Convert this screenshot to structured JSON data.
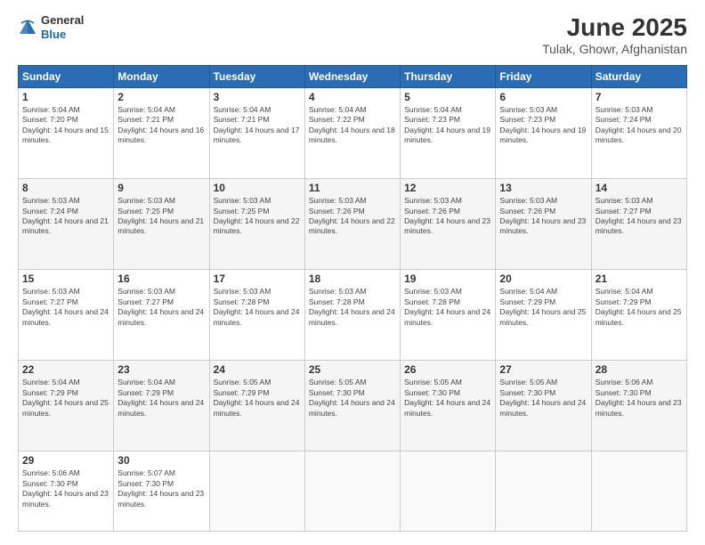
{
  "header": {
    "logo_general": "General",
    "logo_blue": "Blue",
    "title": "June 2025",
    "subtitle": "Tulak, Ghowr, Afghanistan"
  },
  "days_of_week": [
    "Sunday",
    "Monday",
    "Tuesday",
    "Wednesday",
    "Thursday",
    "Friday",
    "Saturday"
  ],
  "weeks": [
    [
      {
        "day": "1",
        "sunrise": "5:04 AM",
        "sunset": "7:20 PM",
        "daylight": "14 hours and 15 minutes."
      },
      {
        "day": "2",
        "sunrise": "5:04 AM",
        "sunset": "7:21 PM",
        "daylight": "14 hours and 16 minutes."
      },
      {
        "day": "3",
        "sunrise": "5:04 AM",
        "sunset": "7:21 PM",
        "daylight": "14 hours and 17 minutes."
      },
      {
        "day": "4",
        "sunrise": "5:04 AM",
        "sunset": "7:22 PM",
        "daylight": "14 hours and 18 minutes."
      },
      {
        "day": "5",
        "sunrise": "5:04 AM",
        "sunset": "7:23 PM",
        "daylight": "14 hours and 19 minutes."
      },
      {
        "day": "6",
        "sunrise": "5:03 AM",
        "sunset": "7:23 PM",
        "daylight": "14 hours and 19 minutes."
      },
      {
        "day": "7",
        "sunrise": "5:03 AM",
        "sunset": "7:24 PM",
        "daylight": "14 hours and 20 minutes."
      }
    ],
    [
      {
        "day": "8",
        "sunrise": "5:03 AM",
        "sunset": "7:24 PM",
        "daylight": "14 hours and 21 minutes."
      },
      {
        "day": "9",
        "sunrise": "5:03 AM",
        "sunset": "7:25 PM",
        "daylight": "14 hours and 21 minutes."
      },
      {
        "day": "10",
        "sunrise": "5:03 AM",
        "sunset": "7:25 PM",
        "daylight": "14 hours and 22 minutes."
      },
      {
        "day": "11",
        "sunrise": "5:03 AM",
        "sunset": "7:26 PM",
        "daylight": "14 hours and 22 minutes."
      },
      {
        "day": "12",
        "sunrise": "5:03 AM",
        "sunset": "7:26 PM",
        "daylight": "14 hours and 23 minutes."
      },
      {
        "day": "13",
        "sunrise": "5:03 AM",
        "sunset": "7:26 PM",
        "daylight": "14 hours and 23 minutes."
      },
      {
        "day": "14",
        "sunrise": "5:03 AM",
        "sunset": "7:27 PM",
        "daylight": "14 hours and 23 minutes."
      }
    ],
    [
      {
        "day": "15",
        "sunrise": "5:03 AM",
        "sunset": "7:27 PM",
        "daylight": "14 hours and 24 minutes."
      },
      {
        "day": "16",
        "sunrise": "5:03 AM",
        "sunset": "7:27 PM",
        "daylight": "14 hours and 24 minutes."
      },
      {
        "day": "17",
        "sunrise": "5:03 AM",
        "sunset": "7:28 PM",
        "daylight": "14 hours and 24 minutes."
      },
      {
        "day": "18",
        "sunrise": "5:03 AM",
        "sunset": "7:28 PM",
        "daylight": "14 hours and 24 minutes."
      },
      {
        "day": "19",
        "sunrise": "5:03 AM",
        "sunset": "7:28 PM",
        "daylight": "14 hours and 24 minutes."
      },
      {
        "day": "20",
        "sunrise": "5:04 AM",
        "sunset": "7:29 PM",
        "daylight": "14 hours and 25 minutes."
      },
      {
        "day": "21",
        "sunrise": "5:04 AM",
        "sunset": "7:29 PM",
        "daylight": "14 hours and 25 minutes."
      }
    ],
    [
      {
        "day": "22",
        "sunrise": "5:04 AM",
        "sunset": "7:29 PM",
        "daylight": "14 hours and 25 minutes."
      },
      {
        "day": "23",
        "sunrise": "5:04 AM",
        "sunset": "7:29 PM",
        "daylight": "14 hours and 24 minutes."
      },
      {
        "day": "24",
        "sunrise": "5:05 AM",
        "sunset": "7:29 PM",
        "daylight": "14 hours and 24 minutes."
      },
      {
        "day": "25",
        "sunrise": "5:05 AM",
        "sunset": "7:30 PM",
        "daylight": "14 hours and 24 minutes."
      },
      {
        "day": "26",
        "sunrise": "5:05 AM",
        "sunset": "7:30 PM",
        "daylight": "14 hours and 24 minutes."
      },
      {
        "day": "27",
        "sunrise": "5:05 AM",
        "sunset": "7:30 PM",
        "daylight": "14 hours and 24 minutes."
      },
      {
        "day": "28",
        "sunrise": "5:06 AM",
        "sunset": "7:30 PM",
        "daylight": "14 hours and 23 minutes."
      }
    ],
    [
      {
        "day": "29",
        "sunrise": "5:06 AM",
        "sunset": "7:30 PM",
        "daylight": "14 hours and 23 minutes."
      },
      {
        "day": "30",
        "sunrise": "5:07 AM",
        "sunset": "7:30 PM",
        "daylight": "14 hours and 23 minutes."
      },
      null,
      null,
      null,
      null,
      null
    ]
  ],
  "labels": {
    "sunrise": "Sunrise:",
    "sunset": "Sunset:",
    "daylight": "Daylight:"
  }
}
